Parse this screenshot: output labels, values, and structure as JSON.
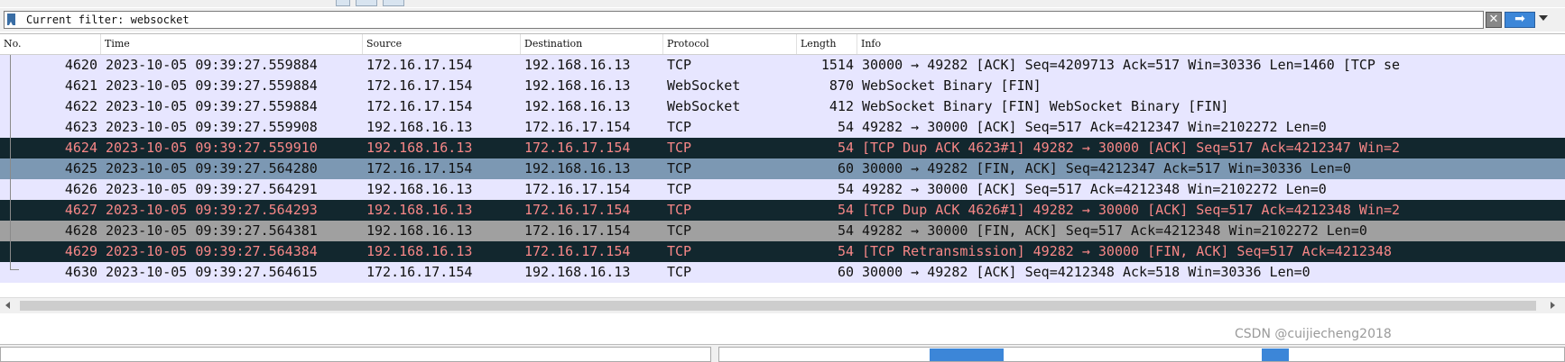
{
  "filter": {
    "text": "Current filter: websocket",
    "clear_icon": "clear-icon",
    "apply_icon": "arrow-right-icon",
    "clear_glyph": "✕",
    "apply_glyph": "➡"
  },
  "columns": [
    "No.",
    "Time",
    "Source",
    "Destination",
    "Protocol",
    "Length",
    "Info"
  ],
  "packets": [
    {
      "no": "4620",
      "time": "2023-10-05 09:39:27.559884",
      "src": "172.16.17.154",
      "dst": "192.168.16.13",
      "proto": "TCP",
      "len": "1514",
      "info": "30000 → 49282 [ACK] Seq=4209713 Ack=517 Win=30336 Len=1460 [TCP se",
      "style": "light"
    },
    {
      "no": "4621",
      "time": "2023-10-05 09:39:27.559884",
      "src": "172.16.17.154",
      "dst": "192.168.16.13",
      "proto": "WebSocket",
      "len": "870",
      "info": "WebSocket Binary [FIN]",
      "style": "light"
    },
    {
      "no": "4622",
      "time": "2023-10-05 09:39:27.559884",
      "src": "172.16.17.154",
      "dst": "192.168.16.13",
      "proto": "WebSocket",
      "len": "412",
      "info": "WebSocket Binary [FIN] WebSocket Binary [FIN]",
      "style": "light"
    },
    {
      "no": "4623",
      "time": "2023-10-05 09:39:27.559908",
      "src": "192.168.16.13",
      "dst": "172.16.17.154",
      "proto": "TCP",
      "len": "54",
      "info": "49282 → 30000 [ACK] Seq=517 Ack=4212347 Win=2102272 Len=0",
      "style": "light"
    },
    {
      "no": "4624",
      "time": "2023-10-05 09:39:27.559910",
      "src": "192.168.16.13",
      "dst": "172.16.17.154",
      "proto": "TCP",
      "len": "54",
      "info": "[TCP Dup ACK 4623#1] 49282 → 30000 [ACK] Seq=517 Ack=4212347 Win=2",
      "style": "dark"
    },
    {
      "no": "4625",
      "time": "2023-10-05 09:39:27.564280",
      "src": "172.16.17.154",
      "dst": "192.168.16.13",
      "proto": "TCP",
      "len": "60",
      "info": "30000 → 49282 [FIN, ACK] Seq=4212347 Ack=517 Win=30336 Len=0",
      "style": "selected"
    },
    {
      "no": "4626",
      "time": "2023-10-05 09:39:27.564291",
      "src": "192.168.16.13",
      "dst": "172.16.17.154",
      "proto": "TCP",
      "len": "54",
      "info": "49282 → 30000 [ACK] Seq=517 Ack=4212348 Win=2102272 Len=0",
      "style": "light"
    },
    {
      "no": "4627",
      "time": "2023-10-05 09:39:27.564293",
      "src": "192.168.16.13",
      "dst": "172.16.17.154",
      "proto": "TCP",
      "len": "54",
      "info": "[TCP Dup ACK 4626#1] 49282 → 30000 [ACK] Seq=517 Ack=4212348 Win=2",
      "style": "dark"
    },
    {
      "no": "4628",
      "time": "2023-10-05 09:39:27.564381",
      "src": "192.168.16.13",
      "dst": "172.16.17.154",
      "proto": "TCP",
      "len": "54",
      "info": "49282 → 30000 [FIN, ACK] Seq=517 Ack=4212348 Win=2102272 Len=0",
      "style": "gray"
    },
    {
      "no": "4629",
      "time": "2023-10-05 09:39:27.564384",
      "src": "192.168.16.13",
      "dst": "172.16.17.154",
      "proto": "TCP",
      "len": "54",
      "info": "[TCP Retransmission] 49282 → 30000 [FIN, ACK] Seq=517 Ack=4212348",
      "style": "dark"
    },
    {
      "no": "4630",
      "time": "2023-10-05 09:39:27.564615",
      "src": "172.16.17.154",
      "dst": "192.168.16.13",
      "proto": "TCP",
      "len": "60",
      "info": "30000 → 49282 [ACK] Seq=4212348 Ack=518 Win=30336 Len=0",
      "style": "light"
    }
  ],
  "colors": {
    "light_row": "#e7e6ff",
    "dark_row": "#12272e",
    "dark_row_text": "#f78787",
    "selected_row": "#7c98b3",
    "gray_row": "#a0a0a0"
  },
  "watermark": "CSDN @cuijiecheng2018"
}
